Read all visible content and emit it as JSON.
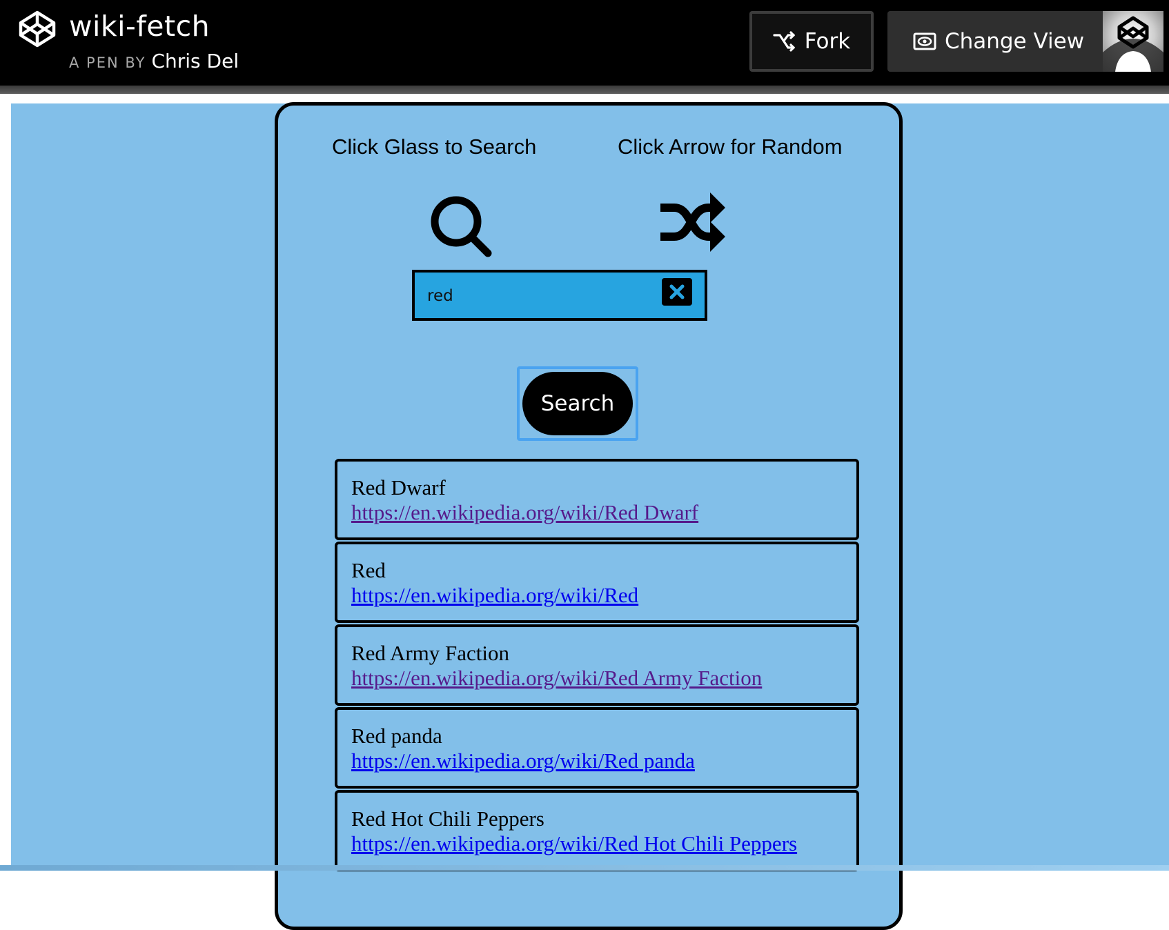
{
  "header": {
    "pen_title": "wiki-fetch",
    "by_label": "A PEN BY",
    "author": "Chris Del",
    "fork_label": "Fork",
    "change_view_label": "Change View",
    "logo_icon": "codepen-logo-icon",
    "avatar_icon": "codepen-avatar-icon"
  },
  "app": {
    "hint_search": "Click Glass to Search",
    "hint_random": "Click Arrow for Random",
    "search_value": "red",
    "search_placeholder": "",
    "search_button_label": "Search",
    "colors": {
      "background": "#82bfe9",
      "input": "#27a4e0",
      "visited_link": "#551a8b",
      "link": "#0000ee"
    }
  },
  "results": [
    {
      "title": "Red Dwarf",
      "url": "https://en.wikipedia.org/wiki/Red Dwarf",
      "visited": true
    },
    {
      "title": "Red",
      "url": "https://en.wikipedia.org/wiki/Red",
      "visited": false
    },
    {
      "title": "Red Army Faction",
      "url": "https://en.wikipedia.org/wiki/Red Army Faction",
      "visited": true
    },
    {
      "title": "Red panda",
      "url": "https://en.wikipedia.org/wiki/Red panda",
      "visited": false
    },
    {
      "title": "Red Hot Chili Peppers",
      "url": "https://en.wikipedia.org/wiki/Red Hot Chili Peppers",
      "visited": false
    }
  ]
}
